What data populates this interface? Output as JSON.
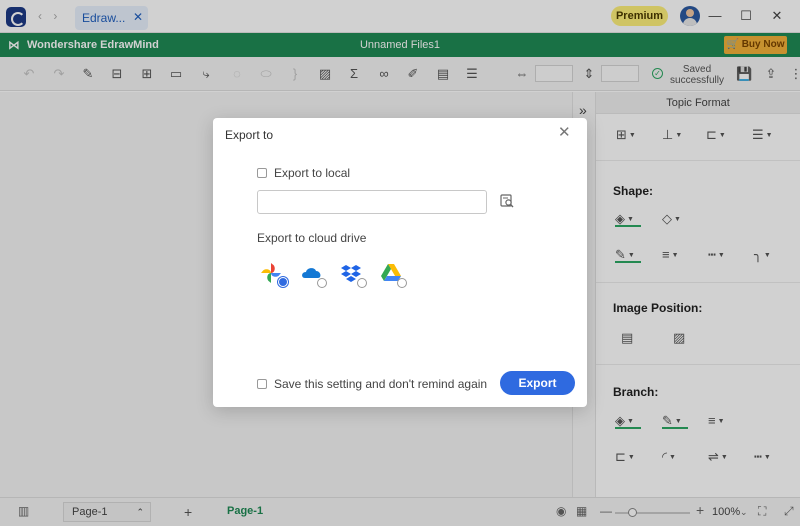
{
  "titlebar": {
    "tab_label": "Edraw...",
    "tab_close": "✕",
    "nav_arrows": "‹ ›",
    "premium": "Premium",
    "minimize": "—",
    "maximize": "☐",
    "close": "✕"
  },
  "brandbar": {
    "brand_mark": "⋈",
    "brand_name": "Wondershare EdrawMind",
    "doc_title": "Unnamed Files1",
    "buy_now": "🛒 Buy Now"
  },
  "toolbar": {
    "saved_text": "Saved successfully",
    "saved_check": "✓",
    "icons": [
      "undo-icon",
      "redo-icon",
      "format-painter-icon",
      "topic-icon",
      "subtopic-icon",
      "floating-topic-icon",
      "relationship-icon",
      "callout-icon",
      "boundary-icon",
      "summary-icon",
      "image-icon",
      "formula-icon",
      "link-icon",
      "mark-icon",
      "comment-icon",
      "outline-icon",
      "width-icon",
      "height-icon",
      "save-icon",
      "share-icon",
      "more-icon"
    ]
  },
  "panel": {
    "title": "Topic Format",
    "sections": {
      "shape": "Shape:",
      "image_position": "Image Position:",
      "branch": "Branch:"
    }
  },
  "statusbar": {
    "page_select": "Page-1",
    "page_tab": "Page-1",
    "add_page": "+",
    "zoom": "100%",
    "zoom_caret": "⌄",
    "zoom_minus": "—",
    "zoom_plus": "+"
  },
  "dialog": {
    "title": "Export to",
    "close": "✕",
    "export_local_label": "Export to local",
    "path_value": "",
    "cloud_label": "Export to cloud drive",
    "remember_label": "Save this setting and don't remind again",
    "export_button": "Export",
    "cloud_drives": [
      "google-photos",
      "onedrive",
      "dropbox",
      "google-drive"
    ],
    "selected_drive": "google-photos"
  },
  "colors": {
    "brand_green": "#1f8a55",
    "accent_blue": "#2f6ae0",
    "premium_yellow": "#fdf07a",
    "buy_now_orange": "#f2b13a"
  }
}
